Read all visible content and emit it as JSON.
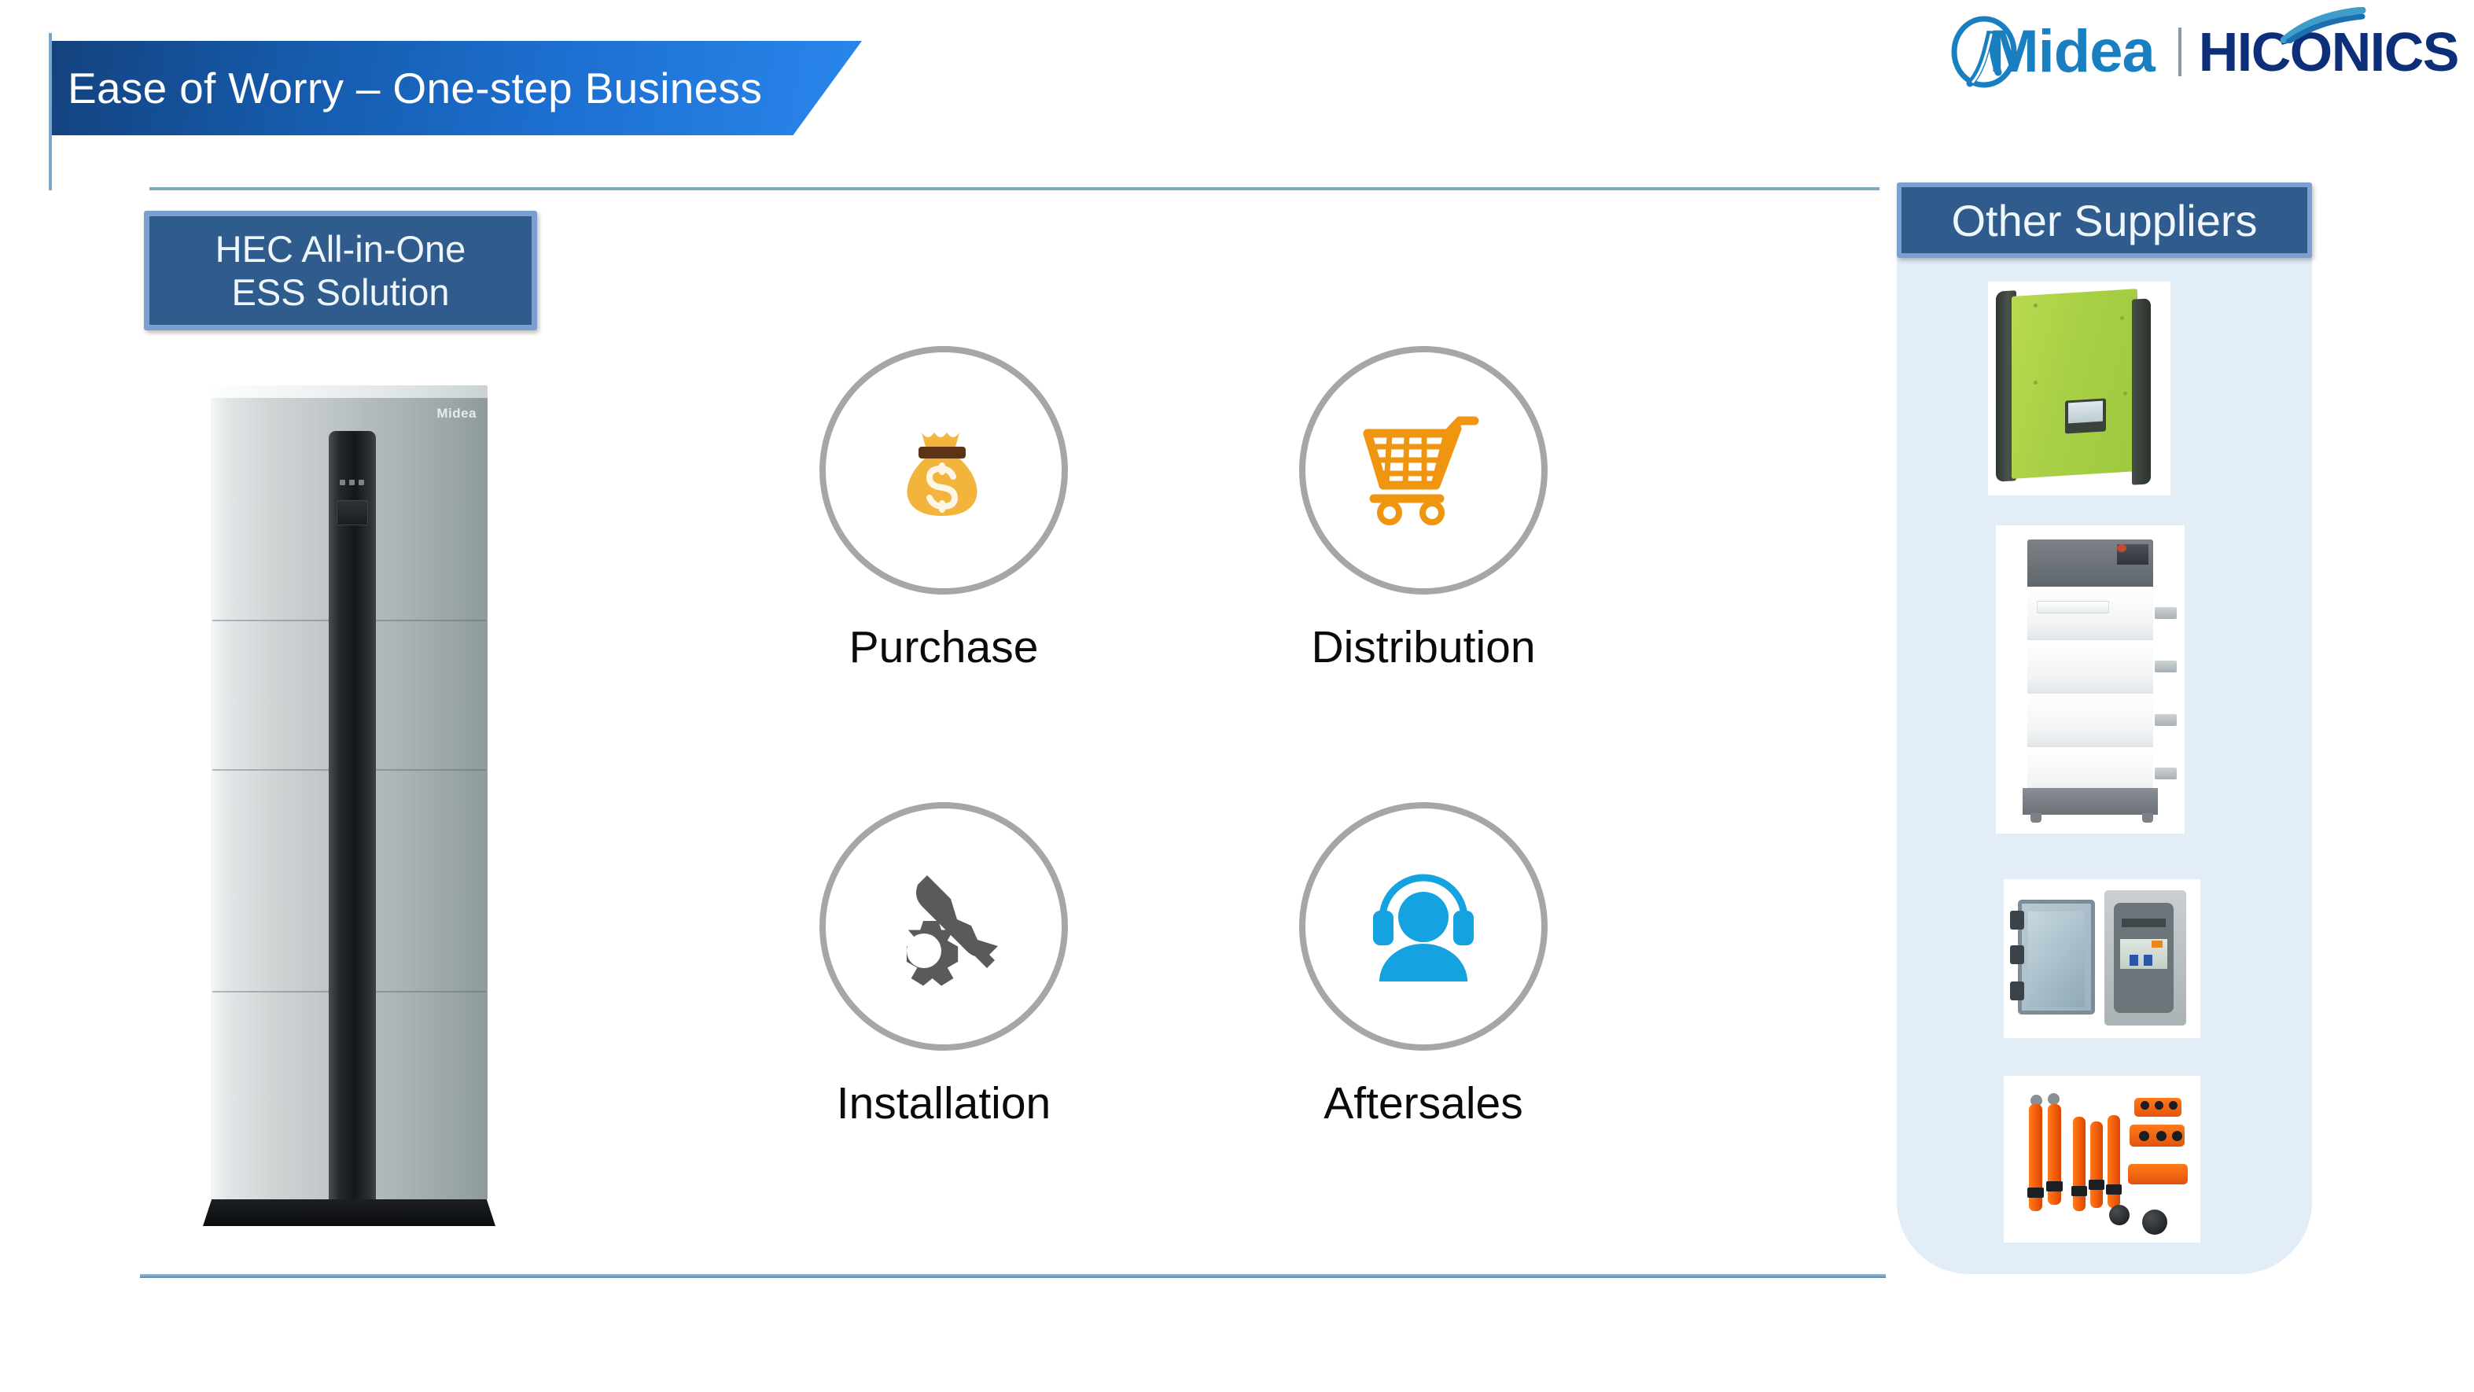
{
  "slide": {
    "title": "Ease of Worry – One-step Business"
  },
  "logo": {
    "brand": "Midea",
    "sub_brand": "HICONICS",
    "brand_color": "#1a7fc1",
    "sub_brand_color": "#0d2f7a"
  },
  "product": {
    "label_line1": "HEC All-in-One",
    "label_line2": "ESS Solution",
    "unit_brand": "Midea",
    "box_fill": "#2f5c8d",
    "box_border": "#7ba0cf"
  },
  "process": {
    "steps": [
      {
        "label": "Purchase",
        "icon": "money-bag-icon",
        "color": "#f0ab25"
      },
      {
        "label": "Distribution",
        "icon": "shopping-cart-icon",
        "color": "#ef9510"
      },
      {
        "label": "Installation",
        "icon": "gear-wrench-icon",
        "color": "#5a5a5a"
      },
      {
        "label": "Aftersales",
        "icon": "support-agent-icon",
        "color": "#14a3e0"
      }
    ],
    "circle_border_color": "#a6a6a6"
  },
  "suppliers": {
    "header": "Other Suppliers",
    "panel_color": "#e2edf7",
    "items": [
      {
        "name": "green-inverter"
      },
      {
        "name": "stacked-battery-tower"
      },
      {
        "name": "combiner-box"
      },
      {
        "name": "cable-harness-kit"
      }
    ]
  },
  "theme": {
    "banner_gradient_start": "#14427e",
    "banner_gradient_end": "#2a86ec",
    "rule_color": "#7ea6c0"
  }
}
